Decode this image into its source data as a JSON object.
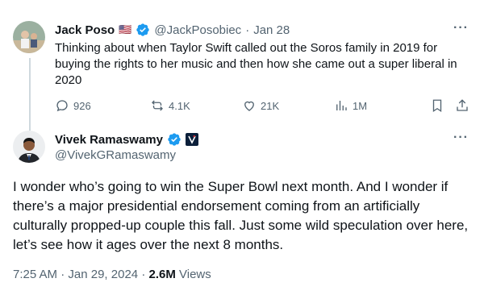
{
  "reply_tweet": {
    "author_name": "Jack Poso",
    "flag": "🇺🇸",
    "handle": "@JackPosobiec",
    "separator": "·",
    "date": "Jan 28",
    "text": "Thinking about when Taylor Swift called out the Soros family in 2019 for buying the rights to her music and then how she came out a super liberal in 2020",
    "actions": {
      "replies": "926",
      "reposts": "4.1K",
      "likes": "21K",
      "views": "1M"
    }
  },
  "main_tweet": {
    "author_name": "Vivek Ramaswamy",
    "handle": "@VivekGRamaswamy",
    "text": "I wonder who’s going to win the Super Bowl next month. And I wonder if there’s a major presidential endorsement coming from an artificially culturally propped-up couple this fall. Just some wild speculation over here, let’s see how it ages over the next 8 months.",
    "time": "7:25 AM",
    "dot": "·",
    "date": "Jan 29, 2024",
    "views_count": "2.6M",
    "views_label": "Views"
  },
  "more_label": "···",
  "colors": {
    "verified_blue": "#1d9bf0",
    "muted_text": "#536471",
    "thread_line": "#cfd9de"
  }
}
